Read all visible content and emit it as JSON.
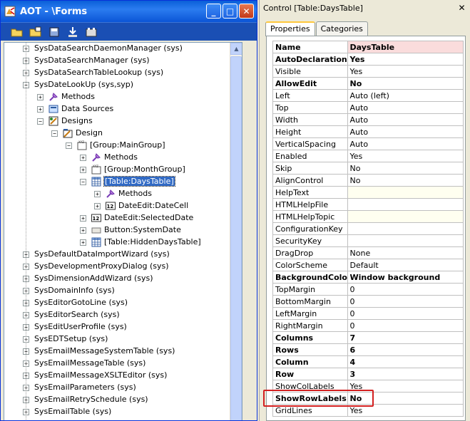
{
  "aot_window": {
    "title": "AOT - \\Forms",
    "minimize": "_",
    "maximize": "□",
    "close": "✕"
  },
  "toolbar": {
    "items": [
      "open-icon",
      "properties-icon",
      "save-icon",
      "import-icon",
      "compile-icon"
    ]
  },
  "tree": {
    "items": [
      {
        "label": "SysDataSearchDaemonManager (sys)",
        "exp": "+",
        "icon": "form-icon"
      },
      {
        "label": "SysDataSearchManager (sys)",
        "exp": "+",
        "icon": "form-icon"
      },
      {
        "label": "SysDataSearchTableLookup (sys)",
        "exp": "+",
        "icon": "form-icon"
      },
      {
        "label": "SysDateLookUp (sys,syp)",
        "exp": "−",
        "icon": "form-icon"
      },
      {
        "label": "Methods",
        "exp": "+",
        "icon": "methods-icon"
      },
      {
        "label": "Data Sources",
        "exp": "+",
        "icon": "datasource-icon"
      },
      {
        "label": "Designs",
        "exp": "−",
        "icon": "designs-icon"
      },
      {
        "label": "Design",
        "exp": "−",
        "icon": "design-icon"
      },
      {
        "label": "[Group:MainGroup]",
        "exp": "−",
        "icon": "group-icon"
      },
      {
        "label": "Methods",
        "exp": "+",
        "icon": "methods-icon"
      },
      {
        "label": "[Group:MonthGroup]",
        "exp": "+",
        "icon": "group-icon"
      },
      {
        "label": "[Table:DaysTable]",
        "exp": "−",
        "icon": "table-icon",
        "selected": true
      },
      {
        "label": "Methods",
        "exp": "+",
        "icon": "methods-icon"
      },
      {
        "label": "DateEdit:DateCell",
        "exp": "+",
        "icon": "dateedit-icon"
      },
      {
        "label": "DateEdit:SelectedDate",
        "exp": "+",
        "icon": "dateedit-icon"
      },
      {
        "label": "Button:SystemDate",
        "exp": "+",
        "icon": "button-icon"
      },
      {
        "label": "[Table:HiddenDaysTable]",
        "exp": "+",
        "icon": "table-icon"
      },
      {
        "label": "SysDefaultDataImportWizard (sys)",
        "exp": "+",
        "icon": "form-icon"
      },
      {
        "label": "SysDevelopmentProxyDialog (sys)",
        "exp": "+",
        "icon": "form-icon"
      },
      {
        "label": "SysDimensionAddWizard (sys)",
        "exp": "+",
        "icon": "form-icon"
      },
      {
        "label": "SysDomainInfo (sys)",
        "exp": "+",
        "icon": "form-icon"
      },
      {
        "label": "SysEditorGotoLine (sys)",
        "exp": "+",
        "icon": "form-icon"
      },
      {
        "label": "SysEditorSearch (sys)",
        "exp": "+",
        "icon": "form-icon"
      },
      {
        "label": "SysEditUserProfile (sys)",
        "exp": "+",
        "icon": "form-icon"
      },
      {
        "label": "SysEDTSetup (sys)",
        "exp": "+",
        "icon": "form-icon"
      },
      {
        "label": "SysEmailMessageSystemTable (sys)",
        "exp": "+",
        "icon": "form-icon"
      },
      {
        "label": "SysEmailMessageTable (sys)",
        "exp": "+",
        "icon": "form-icon"
      },
      {
        "label": "SysEmailMessageXSLTEditor (sys)",
        "exp": "+",
        "icon": "form-icon"
      },
      {
        "label": "SysEmailParameters (sys)",
        "exp": "+",
        "icon": "form-icon"
      },
      {
        "label": "SysEmailRetrySchedule (sys)",
        "exp": "+",
        "icon": "form-icon"
      },
      {
        "label": "SysEmailTable (sys)",
        "exp": "+",
        "icon": "form-icon"
      }
    ]
  },
  "properties_window": {
    "title": "Control [Table:DaysTable]",
    "close": "✕",
    "tabs": [
      {
        "label": "Properties",
        "active": true
      },
      {
        "label": "Categories",
        "active": false
      }
    ],
    "header": {
      "name": "Name",
      "value": "DaysTable"
    },
    "rows": [
      {
        "name": "AutoDeclaration",
        "value": "Yes",
        "bold": true
      },
      {
        "name": "Visible",
        "value": "Yes"
      },
      {
        "name": "AllowEdit",
        "value": "No",
        "bold": true
      },
      {
        "name": "Left",
        "value": "Auto (left)"
      },
      {
        "name": "Top",
        "value": "Auto"
      },
      {
        "name": "Width",
        "value": "Auto"
      },
      {
        "name": "Height",
        "value": "Auto"
      },
      {
        "name": "VerticalSpacing",
        "value": "Auto"
      },
      {
        "name": "Enabled",
        "value": "Yes"
      },
      {
        "name": "Skip",
        "value": "No"
      },
      {
        "name": "AlignControl",
        "value": "No"
      },
      {
        "name": "HelpText",
        "value": "",
        "yellow": true
      },
      {
        "name": "HTMLHelpFile",
        "value": ""
      },
      {
        "name": "HTMLHelpTopic",
        "value": "",
        "yellow": true
      },
      {
        "name": "ConfigurationKey",
        "value": ""
      },
      {
        "name": "SecurityKey",
        "value": ""
      },
      {
        "name": "DragDrop",
        "value": "None"
      },
      {
        "name": "ColorScheme",
        "value": "Default"
      },
      {
        "name": "BackgroundColor",
        "value": "Window background",
        "bold": true
      },
      {
        "name": "TopMargin",
        "value": "0"
      },
      {
        "name": "BottomMargin",
        "value": "0"
      },
      {
        "name": "LeftMargin",
        "value": "0"
      },
      {
        "name": "RightMargin",
        "value": "0"
      },
      {
        "name": "Columns",
        "value": "7",
        "bold": true
      },
      {
        "name": "Rows",
        "value": "6",
        "bold": true
      },
      {
        "name": "Column",
        "value": "4",
        "bold": true
      },
      {
        "name": "Row",
        "value": "3",
        "bold": true
      },
      {
        "name": "ShowColLabels",
        "value": "Yes"
      },
      {
        "name": "ShowRowLabels",
        "value": "No",
        "bold": true
      },
      {
        "name": "GridLines",
        "value": "Yes"
      }
    ]
  },
  "colors": {
    "title_bar": "#0a5fd8",
    "selection": "#316ac5",
    "highlight_box": "#d32020",
    "name_header_bg": "#fadcdc"
  }
}
